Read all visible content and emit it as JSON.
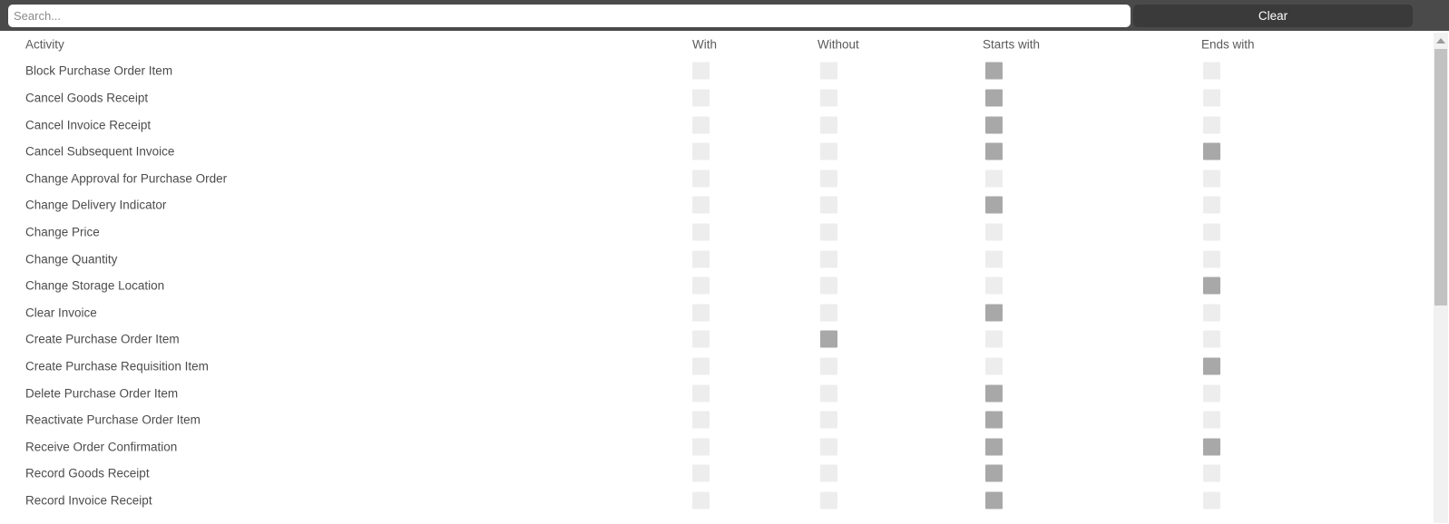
{
  "search": {
    "placeholder": "Search...",
    "value": "",
    "clear_label": "Clear"
  },
  "colors": {
    "bar_background": "#4a4a4a",
    "clear_button": "#3a3a3a",
    "checkbox_unchecked": "#ededed",
    "checkbox_checked": "#a8a8a8",
    "text": "#4c4c4c",
    "scrollbar_thumb": "#c2c2c2",
    "scrollbar_track": "#f1f1f1"
  },
  "table": {
    "columns": [
      {
        "key": "activity",
        "label": "Activity"
      },
      {
        "key": "with",
        "label": "With"
      },
      {
        "key": "without",
        "label": "Without"
      },
      {
        "key": "starts_with",
        "label": "Starts with"
      },
      {
        "key": "ends_with",
        "label": "Ends with"
      }
    ],
    "rows": [
      {
        "activity": "Block Purchase Order Item",
        "with": false,
        "without": false,
        "starts_with": true,
        "ends_with": false
      },
      {
        "activity": "Cancel Goods Receipt",
        "with": false,
        "without": false,
        "starts_with": true,
        "ends_with": false
      },
      {
        "activity": "Cancel Invoice Receipt",
        "with": false,
        "without": false,
        "starts_with": true,
        "ends_with": false
      },
      {
        "activity": "Cancel Subsequent Invoice",
        "with": false,
        "without": false,
        "starts_with": true,
        "ends_with": true
      },
      {
        "activity": "Change Approval for Purchase Order",
        "with": false,
        "without": false,
        "starts_with": false,
        "ends_with": false
      },
      {
        "activity": "Change Delivery Indicator",
        "with": false,
        "without": false,
        "starts_with": true,
        "ends_with": false
      },
      {
        "activity": "Change Price",
        "with": false,
        "without": false,
        "starts_with": false,
        "ends_with": false
      },
      {
        "activity": "Change Quantity",
        "with": false,
        "without": false,
        "starts_with": false,
        "ends_with": false
      },
      {
        "activity": "Change Storage Location",
        "with": false,
        "without": false,
        "starts_with": false,
        "ends_with": true
      },
      {
        "activity": "Clear Invoice",
        "with": false,
        "without": false,
        "starts_with": true,
        "ends_with": false
      },
      {
        "activity": "Create Purchase Order Item",
        "with": false,
        "without": true,
        "starts_with": false,
        "ends_with": false
      },
      {
        "activity": "Create Purchase Requisition Item",
        "with": false,
        "without": false,
        "starts_with": false,
        "ends_with": true
      },
      {
        "activity": "Delete Purchase Order Item",
        "with": false,
        "without": false,
        "starts_with": true,
        "ends_with": false
      },
      {
        "activity": "Reactivate Purchase Order Item",
        "with": false,
        "without": false,
        "starts_with": true,
        "ends_with": false
      },
      {
        "activity": "Receive Order Confirmation",
        "with": false,
        "without": false,
        "starts_with": true,
        "ends_with": true
      },
      {
        "activity": "Record Goods Receipt",
        "with": false,
        "without": false,
        "starts_with": true,
        "ends_with": false
      },
      {
        "activity": "Record Invoice Receipt",
        "with": false,
        "without": false,
        "starts_with": true,
        "ends_with": false
      }
    ]
  },
  "scrollbar": {
    "up_arrow_icon": "chevron-up-icon"
  }
}
